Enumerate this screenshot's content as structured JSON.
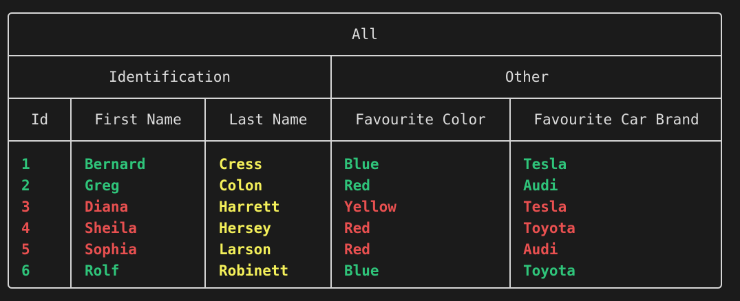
{
  "table": {
    "title": "All",
    "groups": {
      "identification": "Identification",
      "other": "Other"
    },
    "columns": {
      "id": "Id",
      "first_name": "First Name",
      "last_name": "Last Name",
      "favourite_color": "Favourite Color",
      "favourite_car_brand": "Favourite Car Brand"
    },
    "rows": [
      {
        "id": "1",
        "first_name": "Bernard",
        "last_name": "Cress",
        "favourite_color": "Blue",
        "favourite_car_brand": "Tesla",
        "status_color": "#2fc47a"
      },
      {
        "id": "2",
        "first_name": "Greg",
        "last_name": "Colon",
        "favourite_color": "Red",
        "favourite_car_brand": "Audi",
        "status_color": "#2fc47a"
      },
      {
        "id": "3",
        "first_name": "Diana",
        "last_name": "Harrett",
        "favourite_color": "Yellow",
        "favourite_car_brand": "Tesla",
        "status_color": "#e85050"
      },
      {
        "id": "4",
        "first_name": "Sheila",
        "last_name": "Hersey",
        "favourite_color": "Red",
        "favourite_car_brand": "Toyota",
        "status_color": "#e85050"
      },
      {
        "id": "5",
        "first_name": "Sophia",
        "last_name": "Larson",
        "favourite_color": "Red",
        "favourite_car_brand": "Audi",
        "status_color": "#e85050"
      },
      {
        "id": "6",
        "first_name": "Rolf",
        "last_name": "Robinett",
        "favourite_color": "Blue",
        "favourite_car_brand": "Toyota",
        "status_color": "#2fc47a"
      }
    ],
    "last_name_color": "#f4f05a"
  }
}
